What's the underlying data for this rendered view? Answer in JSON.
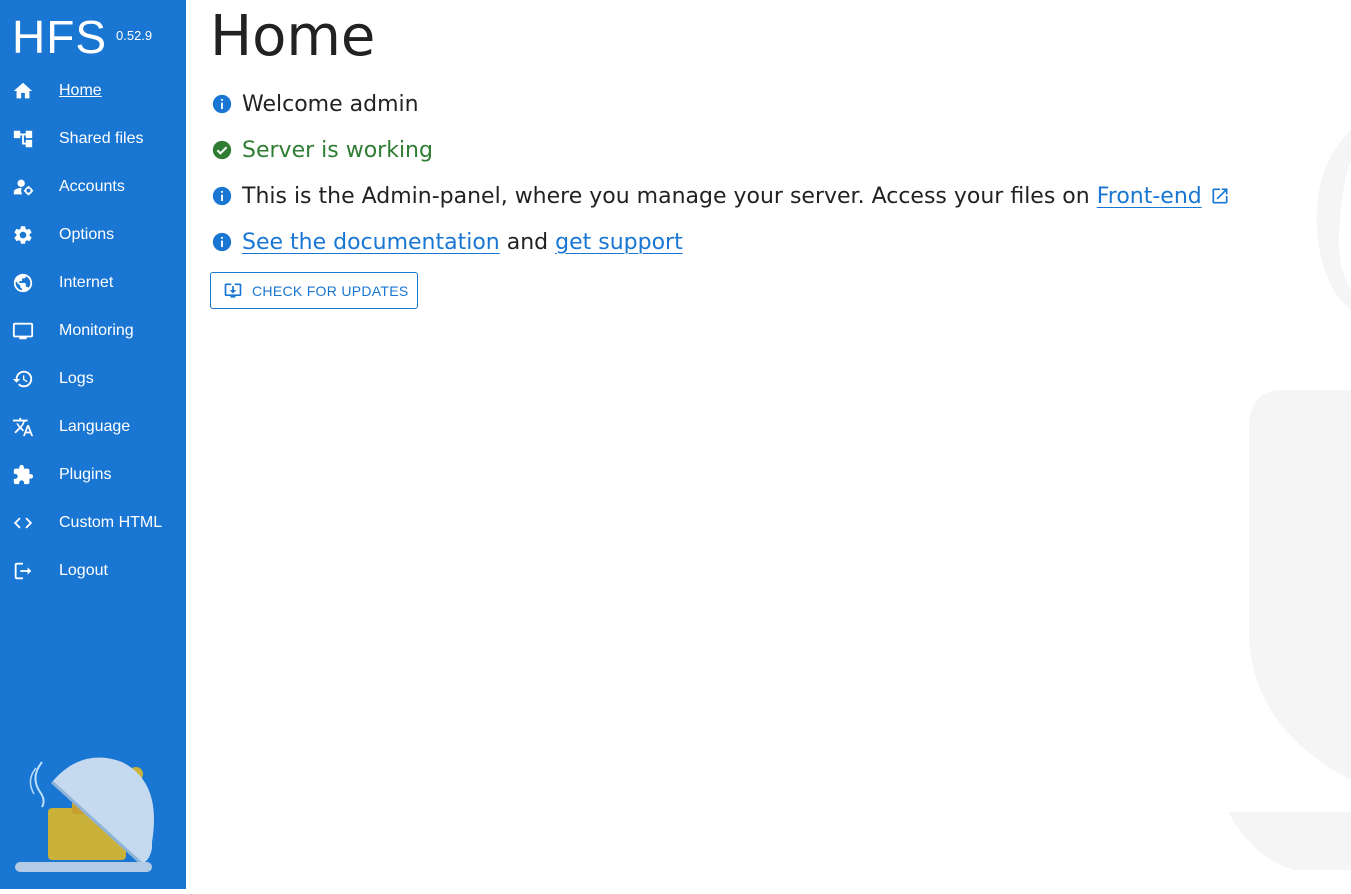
{
  "app": {
    "name": "HFS",
    "version": "0.52.9"
  },
  "sidebar": {
    "items": [
      {
        "label": "Home",
        "icon": "home-icon",
        "active": true
      },
      {
        "label": "Shared files",
        "icon": "account-tree-icon"
      },
      {
        "label": "Accounts",
        "icon": "manage-accounts-icon"
      },
      {
        "label": "Options",
        "icon": "settings-icon"
      },
      {
        "label": "Internet",
        "icon": "globe-icon"
      },
      {
        "label": "Monitoring",
        "icon": "monitor-icon"
      },
      {
        "label": "Logs",
        "icon": "history-icon"
      },
      {
        "label": "Language",
        "icon": "translate-icon"
      },
      {
        "label": "Plugins",
        "icon": "extension-icon"
      },
      {
        "label": "Custom HTML",
        "icon": "code-icon"
      },
      {
        "label": "Logout",
        "icon": "logout-icon"
      }
    ]
  },
  "main": {
    "title": "Home",
    "welcome": "Welcome admin",
    "status": "Server is working",
    "admin_text": "This is the Admin-panel, where you manage your server. Access your files on",
    "frontend_link": "Front-end",
    "docs_link": "See the documentation",
    "and_text": "and",
    "support_link": "get support",
    "update_button": "CHECK FOR UPDATES"
  },
  "colors": {
    "sidebar_bg": "#1976d2",
    "accent": "#1976d2",
    "success": "#2e7d32",
    "text": "#222222"
  }
}
